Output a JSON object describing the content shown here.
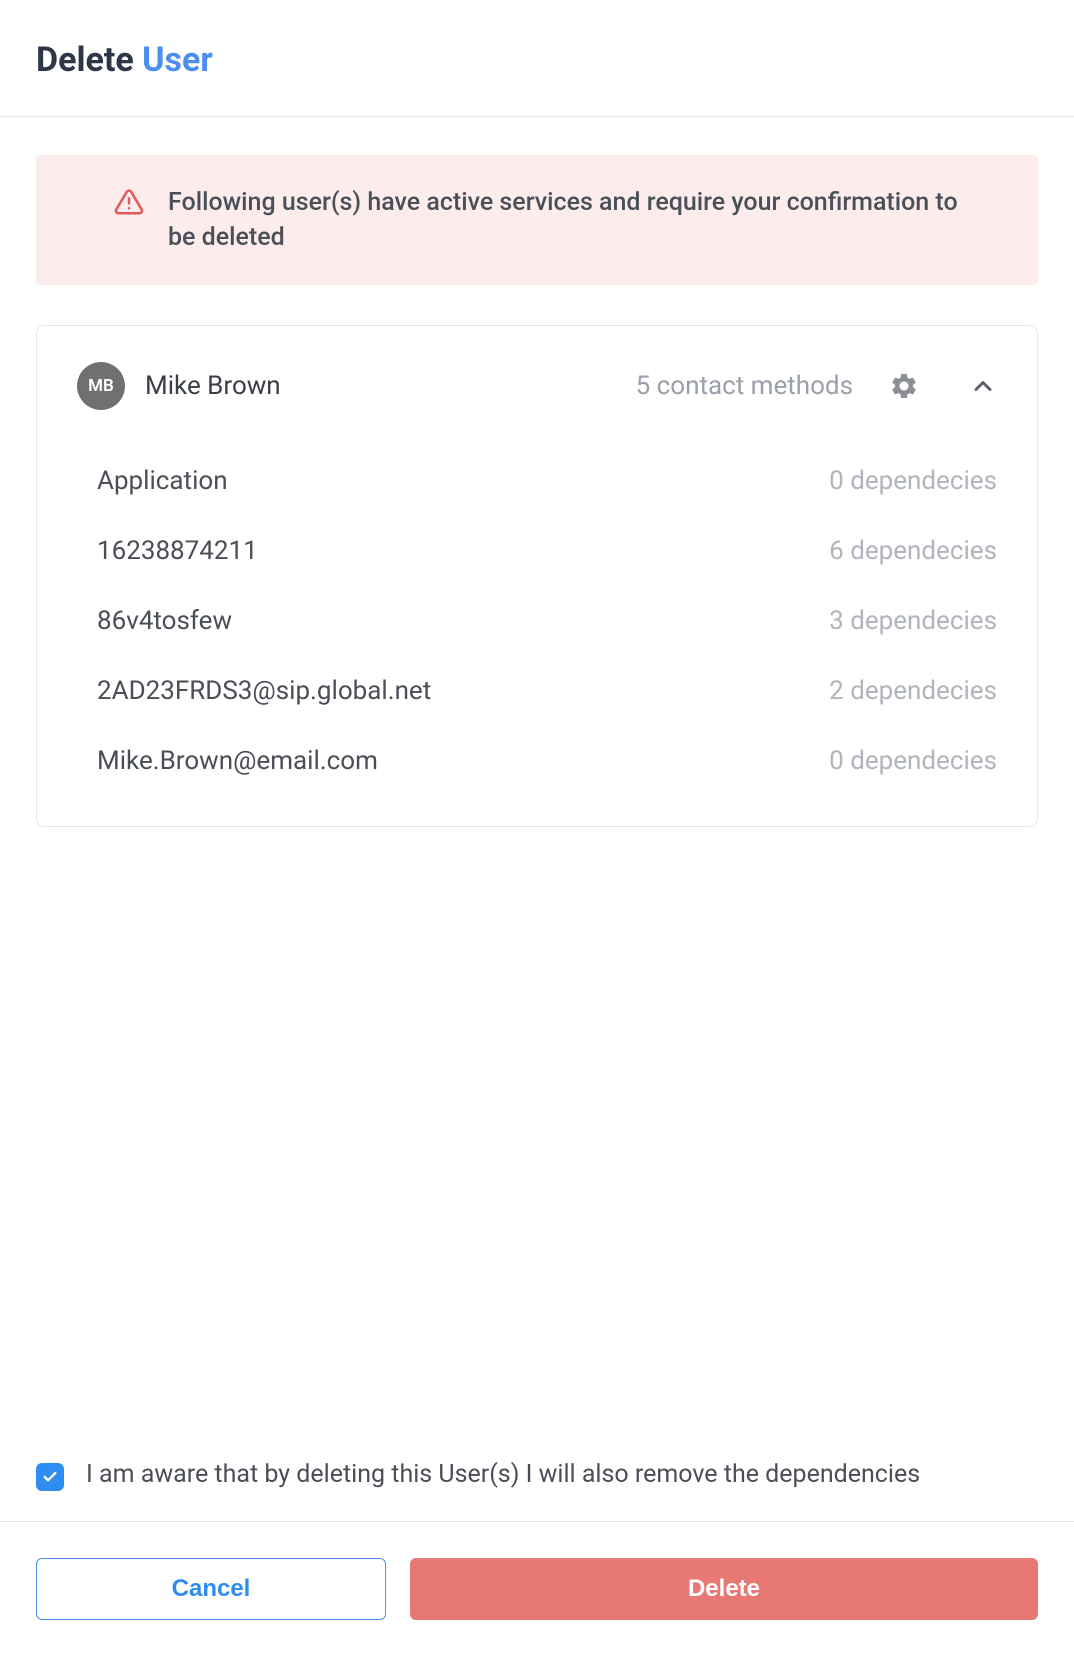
{
  "header": {
    "title_prefix": "Delete ",
    "title_link": "User"
  },
  "alert": {
    "message": "Following user(s) have active services and require your confirmation to be deleted"
  },
  "user": {
    "initials": "MB",
    "name": "Mike Brown",
    "contact_summary": "5 contact methods",
    "contacts": [
      {
        "label": "Application",
        "deps": "0 dependecies"
      },
      {
        "label": "16238874211",
        "deps": "6 dependecies"
      },
      {
        "label": "86v4tosfew",
        "deps": "3 dependecies"
      },
      {
        "label": "2AD23FRDS3@sip.global.net",
        "deps": "2 dependecies"
      },
      {
        "label": "Mike.Brown@email.com",
        "deps": "0 dependecies"
      }
    ]
  },
  "confirm": {
    "text": "I am aware that by deleting this User(s) I will also remove the dependencies"
  },
  "footer": {
    "cancel": "Cancel",
    "delete": "Delete"
  }
}
